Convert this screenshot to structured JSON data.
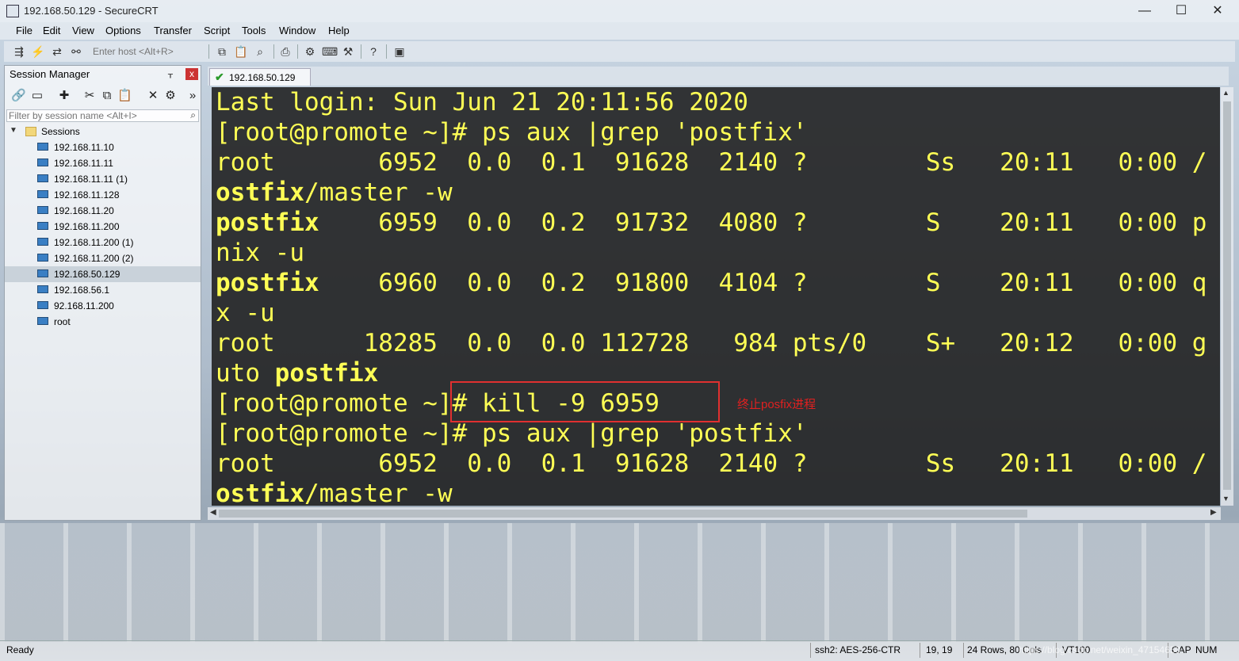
{
  "window": {
    "title": "192.168.50.129 - SecureCRT",
    "minimize": "—",
    "maximize": "☐",
    "close": "✕"
  },
  "menu": [
    "File",
    "Edit",
    "View",
    "Options",
    "Transfer",
    "Script",
    "Tools",
    "Window",
    "Help"
  ],
  "toolbar": {
    "host_placeholder": "Enter host <Alt+R>"
  },
  "session_manager": {
    "title": "Session Manager",
    "pin": "ᚁ",
    "close": "x",
    "filter_placeholder": "Filter by session name <Alt+I>",
    "root_label": "Sessions",
    "sessions": [
      "192.168.11.10",
      "192.168.11.11",
      "192.168.11.11 (1)",
      "192.168.11.128",
      "192.168.11.20",
      "192.168.11.200",
      "192.168.11.200 (1)",
      "192.168.11.200 (2)",
      "192.168.50.129",
      "192.168.56.1",
      "92.168.11.200",
      "root"
    ],
    "selected": "192.168.50.129"
  },
  "tab": {
    "label": "192.168.50.129"
  },
  "terminal": {
    "lines": [
      {
        "pre": "Last login: Sun Jun 21 20:11:56 2020",
        "bold": "",
        "post": ""
      },
      {
        "pre": "[root@promote ~]# ps aux |grep 'postfix'",
        "bold": "",
        "post": ""
      },
      {
        "pre": "root       6952  0.0  0.1  91628  2140 ?        Ss   20:11   0:00 /",
        "bold": "",
        "post": ""
      },
      {
        "pre": "",
        "bold": "ostfix",
        "post": "/master -w"
      },
      {
        "pre": "",
        "bold": "postfix",
        "post": "    6959  0.0  0.2  91732  4080 ?        S    20:11   0:00 p"
      },
      {
        "pre": "nix -u",
        "bold": "",
        "post": ""
      },
      {
        "pre": "",
        "bold": "postfix",
        "post": "    6960  0.0  0.2  91800  4104 ?        S    20:11   0:00 q"
      },
      {
        "pre": "x -u",
        "bold": "",
        "post": ""
      },
      {
        "pre": "root      18285  0.0  0.0 112728   984 pts/0    S+   20:12   0:00 g",
        "bold": "",
        "post": ""
      },
      {
        "pre": "uto ",
        "bold": "postfix",
        "post": ""
      },
      {
        "pre": "[root@promote ~]# kill -9 6959",
        "bold": "",
        "post": ""
      },
      {
        "pre": "[root@promote ~]# ps aux |grep 'postfix'",
        "bold": "",
        "post": ""
      },
      {
        "pre": "root       6952  0.0  0.1  91628  2140 ?        Ss   20:11   0:00 /",
        "bold": "",
        "post": ""
      },
      {
        "pre": "",
        "bold": "ostfix",
        "post": "/master -w"
      }
    ]
  },
  "annotation": {
    "text": "终止posfix进程",
    "color": "#e02020"
  },
  "status": {
    "ready": "Ready",
    "cipher": "ssh2: AES-256-CTR",
    "cursor": "19,  19",
    "size": "24 Rows, 80 Cols",
    "term": "VT100",
    "cap": "CAP",
    "num": "NUM",
    "watermark": "https://blog.csdn.net/weixin_47154650"
  }
}
